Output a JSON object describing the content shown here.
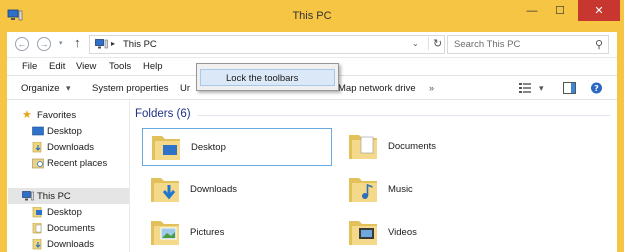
{
  "window": {
    "title": "This PC",
    "min": "—",
    "max": "☐",
    "close": "✕"
  },
  "address": {
    "back": "←",
    "forward": "→",
    "recent": "▾",
    "up": "↑",
    "separator": "▸",
    "path": "This PC",
    "dropdown": "⌄",
    "refresh": "↻",
    "search_placeholder": "Search This PC",
    "search_icon": "⚲"
  },
  "menubar": [
    "File",
    "Edit",
    "View",
    "Tools",
    "Help"
  ],
  "toolbar": {
    "organize": "Organize",
    "organize_chev": "▾",
    "system_properties": "System properties",
    "obscured_partial": "Ur",
    "map_network_drive": "Map network drive",
    "more": "»",
    "view_chev": "▾",
    "help_icon": "?"
  },
  "context_menu": {
    "item": "Lock the toolbars"
  },
  "navigation": {
    "favorites_label": "Favorites",
    "favorites": [
      "Desktop",
      "Downloads",
      "Recent places"
    ],
    "thispc_label": "This PC",
    "thispc_items": [
      "Desktop",
      "Documents",
      "Downloads"
    ]
  },
  "main": {
    "group_header": "Folders (6)",
    "folders": [
      "Desktop",
      "Documents",
      "Downloads",
      "Music",
      "Pictures",
      "Videos"
    ]
  },
  "colors": {
    "frame": "#f6c544",
    "close": "#c7372f",
    "header_text": "#1e3287",
    "selection_border": "#6aa9dd",
    "menu_highlight": "#dbe8f7"
  }
}
